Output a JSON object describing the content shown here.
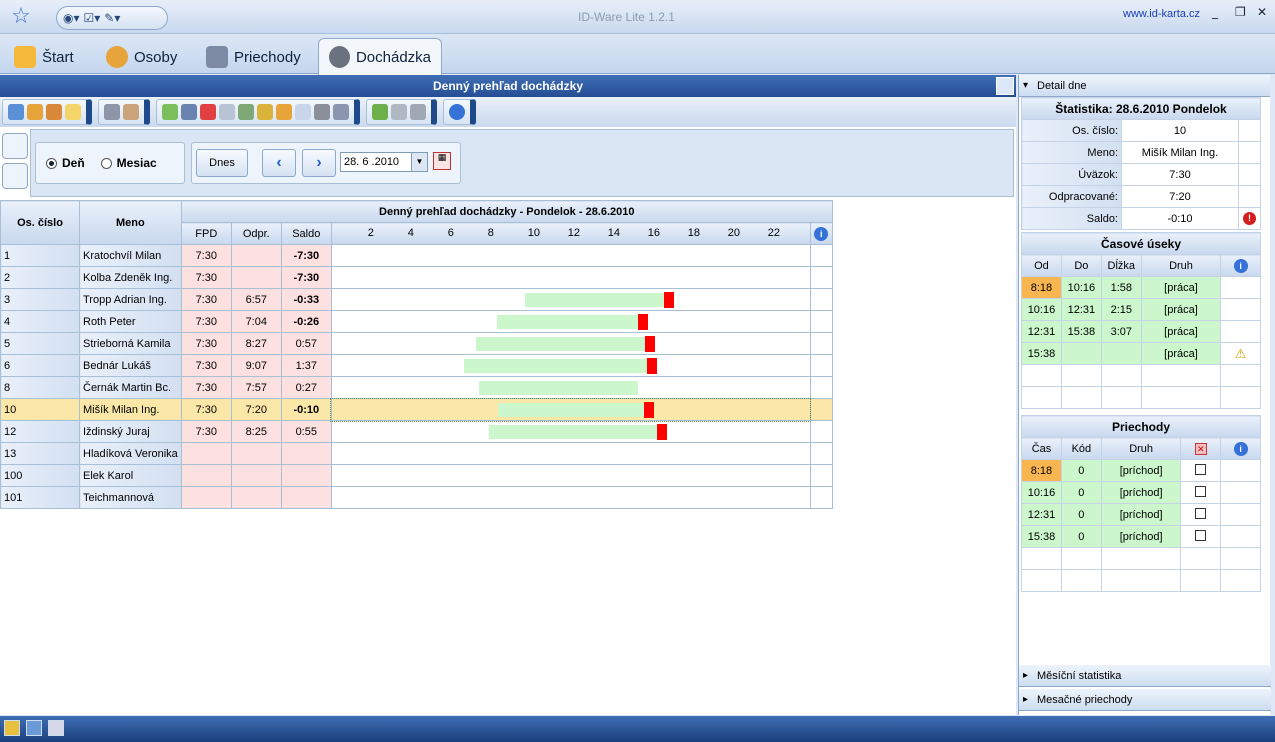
{
  "window": {
    "title": "ID-Ware Lite 1.2.1",
    "url": "www.id-karta.cz",
    "min": "_",
    "restore": "❐",
    "close": "✕"
  },
  "tabs": [
    {
      "label": "Štart",
      "icon": "star-icon",
      "color": "#f5b83b"
    },
    {
      "label": "Osoby",
      "icon": "person-icon",
      "color": "#e6a43a"
    },
    {
      "label": "Priechody",
      "icon": "door-icon",
      "color": "#7c8aa3"
    },
    {
      "label": "Dochádzka",
      "icon": "clock-icon",
      "color": "#6a7280"
    }
  ],
  "main": {
    "title": "Denný prehľad dochádzky",
    "mode": {
      "day": "Deň",
      "month": "Mesiac"
    },
    "today_button": "Dnes",
    "date_value": "28. 6 .2010"
  },
  "grid": {
    "headers": {
      "id": "Os. číslo",
      "name": "Meno",
      "group": "Denný prehľad dochádzky - Pondelok - 28.6.2010"
    },
    "sub": {
      "fpd": "FPD",
      "odpr": "Odpr.",
      "saldo": "Saldo"
    },
    "hours": [
      "2",
      "4",
      "6",
      "8",
      "10",
      "12",
      "14",
      "16",
      "18",
      "20",
      "22"
    ],
    "rows": [
      {
        "id": "1",
        "name": "Kratochvíl Milan",
        "fpd": "7:30",
        "odpr": "",
        "saldo": "-7:30",
        "neg": true,
        "start": null,
        "end": null,
        "mark": false
      },
      {
        "id": "2",
        "name": "Kolba Zdeněk Ing.",
        "fpd": "7:30",
        "odpr": "",
        "saldo": "-7:30",
        "neg": true,
        "start": null,
        "end": null,
        "mark": false
      },
      {
        "id": "3",
        "name": "Tropp Adrian Ing.",
        "fpd": "7:30",
        "odpr": "6:57",
        "saldo": "-0:33",
        "neg": true,
        "start": 9.65,
        "end": 16.6,
        "mark": true
      },
      {
        "id": "4",
        "name": "Roth Peter",
        "fpd": "7:30",
        "odpr": "7:04",
        "saldo": "-0:26",
        "neg": true,
        "start": 8.25,
        "end": 15.3,
        "mark": true
      },
      {
        "id": "5",
        "name": "Strieborná Kamila",
        "fpd": "7:30",
        "odpr": "8:27",
        "saldo": "0:57",
        "neg": false,
        "start": 7.2,
        "end": 15.65,
        "mark": true
      },
      {
        "id": "6",
        "name": "Bednár Lukáš",
        "fpd": "7:30",
        "odpr": "9:07",
        "saldo": "1:37",
        "neg": false,
        "start": 6.6,
        "end": 15.75,
        "mark": true
      },
      {
        "id": "8",
        "name": "Černák Martin Bc.",
        "fpd": "7:30",
        "odpr": "7:57",
        "saldo": "0:27",
        "neg": false,
        "start": 7.35,
        "end": 15.3,
        "mark": false
      },
      {
        "id": "10",
        "name": "Mišík Milan  Ing.",
        "fpd": "7:30",
        "odpr": "7:20",
        "saldo": "-0:10",
        "neg": true,
        "start": 8.3,
        "end": 15.63,
        "mark": true,
        "selected": true
      },
      {
        "id": "12",
        "name": "Iždinský Juraj",
        "fpd": "7:30",
        "odpr": "8:25",
        "saldo": "0:55",
        "neg": false,
        "start": 7.85,
        "end": 16.25,
        "mark": true
      },
      {
        "id": "13",
        "name": "Hladíková Veronika",
        "fpd": "",
        "odpr": "",
        "saldo": "",
        "neg": false,
        "start": null,
        "end": null,
        "mark": false
      },
      {
        "id": "100",
        "name": "Elek Karol",
        "fpd": "",
        "odpr": "",
        "saldo": "",
        "neg": false,
        "start": null,
        "end": null,
        "mark": false
      },
      {
        "id": "101",
        "name": "Teichmannová",
        "fpd": "",
        "odpr": "",
        "saldo": "",
        "neg": false,
        "start": null,
        "end": null,
        "mark": false
      }
    ]
  },
  "detail": {
    "header": "Detail dne",
    "stats_title": "Štatistika: 28.6.2010 Pondelok",
    "fields": [
      {
        "label": "Os. číslo:",
        "value": "10"
      },
      {
        "label": "Meno:",
        "value": "Mišík Milan  Ing."
      },
      {
        "label": "Úväzok:",
        "value": "7:30"
      },
      {
        "label": "Odpracované:",
        "value": "7:20"
      },
      {
        "label": "Saldo:",
        "value": "-0:10"
      }
    ],
    "segments_title": "Časové úseky",
    "seg_cols": [
      "Od",
      "Do",
      "Dĺžka",
      "Druh"
    ],
    "segments": [
      {
        "od": "8:18",
        "do": "10:16",
        "dlzka": "1:58",
        "druh": "[práca]"
      },
      {
        "od": "10:16",
        "do": "12:31",
        "dlzka": "2:15",
        "druh": "[práca]"
      },
      {
        "od": "12:31",
        "do": "15:38",
        "dlzka": "3:07",
        "druh": "[práca]"
      },
      {
        "od": "15:38",
        "do": "",
        "dlzka": "",
        "druh": "[práca]"
      }
    ],
    "passes_title": "Priechody",
    "pass_cols": [
      "Čas",
      "Kód",
      "Druh"
    ],
    "passes": [
      {
        "cas": "8:18",
        "kod": "0",
        "druh": "[príchod]"
      },
      {
        "cas": "10:16",
        "kod": "0",
        "druh": "[príchod]"
      },
      {
        "cas": "12:31",
        "kod": "0",
        "druh": "[príchod]"
      },
      {
        "cas": "15:38",
        "kod": "0",
        "druh": "[príchod]"
      }
    ],
    "monthly_stats": "Měsíční statistika",
    "monthly_passes": "Mesačné priechody"
  }
}
